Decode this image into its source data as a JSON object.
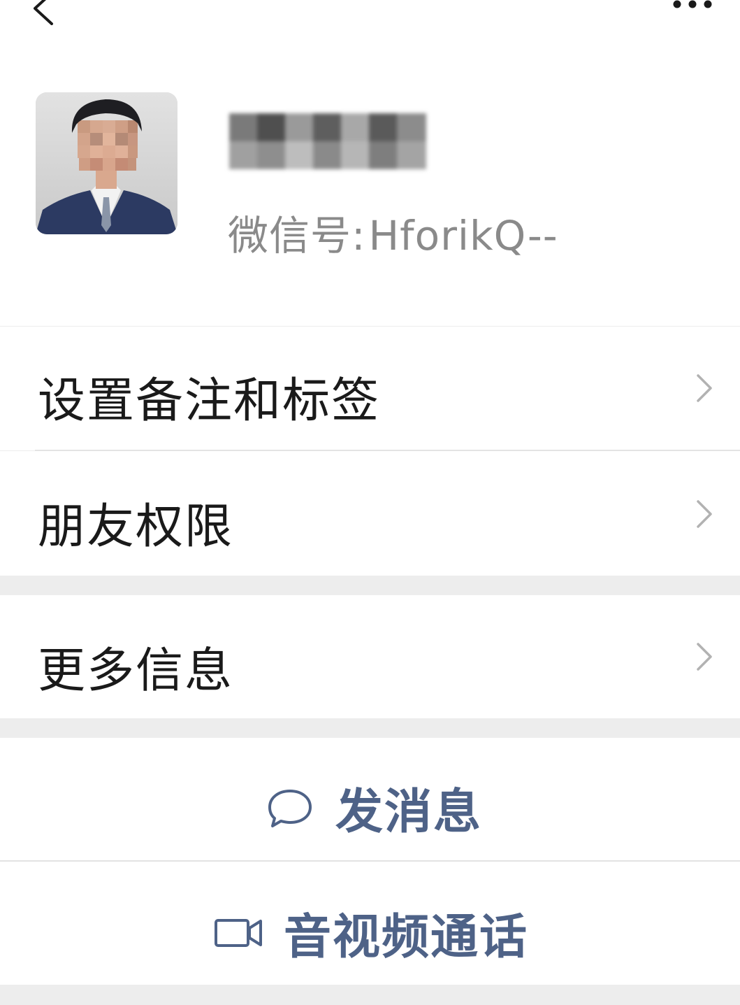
{
  "nav": {
    "back_icon": "chevron-left-icon",
    "more_icon": "ellipsis-icon"
  },
  "profile": {
    "wechat_id_label": "微信号:",
    "wechat_id_value": "HforikQ--"
  },
  "menu": {
    "items": [
      {
        "label": "设置备注和标签"
      },
      {
        "label": "朋友权限"
      },
      {
        "label": "更多信息"
      }
    ]
  },
  "actions": {
    "send_message": {
      "label": "发消息",
      "icon": "chat-bubble-icon"
    },
    "video_call": {
      "label": "音视频通话",
      "icon": "video-camera-icon"
    }
  },
  "colors": {
    "action_text": "#4e6287",
    "background": "#ededed",
    "card": "#ffffff"
  }
}
